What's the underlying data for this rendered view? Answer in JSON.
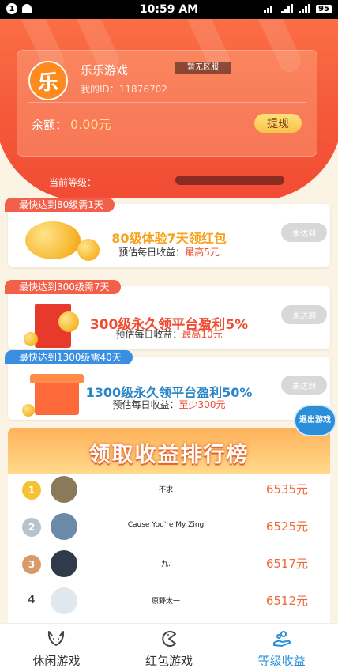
{
  "status_bar": {
    "notif_count": "1",
    "time": "10:59 AM",
    "battery": "95"
  },
  "profile": {
    "app_logo_char": "乐",
    "app_name": "乐乐游戏",
    "user_id": "我的ID：11876702",
    "region_badge": "暂无区服",
    "balance_label": "余额：",
    "balance_amount": "0.00元",
    "withdraw_label": "提现",
    "level_label": "当前等级："
  },
  "tasks": [
    {
      "ribbon": "最快达到80级需1天",
      "title": "80级体验7天领红包",
      "sub_label": "预估每日收益：",
      "sub_value": "最高5元",
      "button": "未达到",
      "title_color": "#f7a21a",
      "ribbon_color": "#f2604a"
    },
    {
      "ribbon": "最快达到300级需7天",
      "title": "300级永久领平台盈利5%",
      "sub_label": "预估每日收益：",
      "sub_value": "最高10元",
      "button": "未达到",
      "title_color": "#ef4b30",
      "ribbon_color": "#f2604a"
    },
    {
      "ribbon": "最快达到1300级需40天",
      "title": "1300级永久领平台盈利50%",
      "sub_label": "预估每日收益：",
      "sub_value": "至少300元",
      "button": "未达到",
      "title_color": "#2a86c8",
      "ribbon_color": "#3a8fe0"
    }
  ],
  "float_button": "退出游戏",
  "leaderboard": {
    "title": "领取收益排行榜",
    "rows": [
      {
        "rank": "1",
        "name": "不求",
        "income": "6535元"
      },
      {
        "rank": "2",
        "name": "Cause You're My Zing",
        "income": "6525元"
      },
      {
        "rank": "3",
        "name": "九.",
        "income": "6517元"
      },
      {
        "rank": "4",
        "name": "原野太一",
        "income": "6512元"
      }
    ]
  },
  "nav": [
    {
      "label": "休闲游戏",
      "icon": "cat-face-icon"
    },
    {
      "label": "红包游戏",
      "icon": "pacman-icon"
    },
    {
      "label": "等级收益",
      "icon": "hand-coins-icon"
    }
  ],
  "colors": {
    "accent_blue": "#2a8fd8",
    "header_red": "#f45a3a",
    "gold": "#f8c24a"
  }
}
